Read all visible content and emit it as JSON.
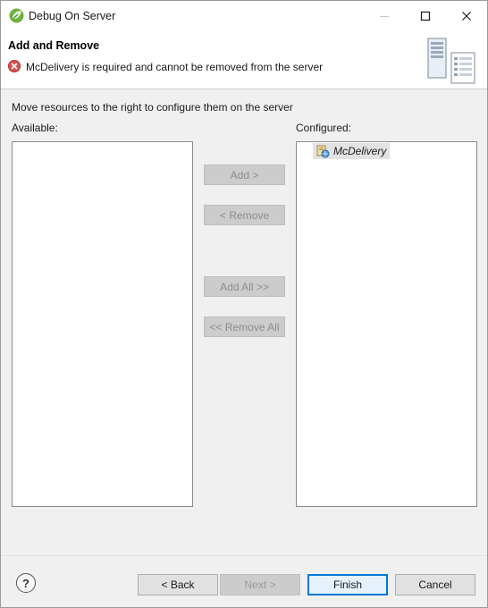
{
  "window": {
    "title": "Debug On Server",
    "app_icon": "spring-leaf-icon",
    "controls": [
      "minimize-icon",
      "maximize-icon",
      "close-icon"
    ]
  },
  "banner": {
    "title": "Add and Remove",
    "message": "McDelivery is required and cannot be removed from the server",
    "message_icon": "error-icon",
    "art_icon": "server-wizard-icon"
  },
  "content": {
    "instruction": "Move resources to the right to configure them on the server",
    "available_label": "Available:",
    "configured_label": "Configured:",
    "available_items": [],
    "configured_items": [
      {
        "label": "McDelivery",
        "icon": "web-project-icon"
      }
    ]
  },
  "actions": {
    "add": "Add >",
    "remove": "< Remove",
    "add_all": "Add All >>",
    "remove_all": "<< Remove All"
  },
  "footer": {
    "help": "?",
    "back": "< Back",
    "next": "Next >",
    "finish": "Finish",
    "cancel": "Cancel"
  },
  "colors": {
    "accent": "#0078d7",
    "error": "#d9534f",
    "disabled_button": "#cccccc"
  }
}
